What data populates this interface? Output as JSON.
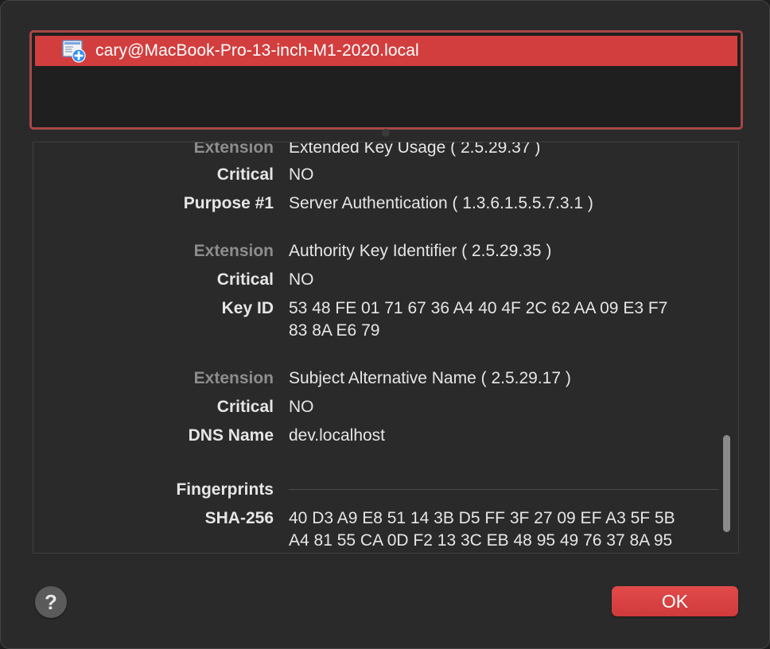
{
  "certificate_list": {
    "selected_item": "cary@MacBook-Pro-13-inch-M1-2020.local",
    "item_icon": "certificate-icon"
  },
  "details": [
    {
      "key": "Extension",
      "value": "Extended Key Usage ( 2.5.29.37 )",
      "dim": true
    },
    {
      "key": "Critical",
      "value": "NO"
    },
    {
      "key": "Purpose #1",
      "value": "Server Authentication ( 1.3.6.1.5.5.7.3.1 )"
    },
    {
      "key": "Extension",
      "value": "Authority Key Identifier ( 2.5.29.35 )",
      "dim": true
    },
    {
      "key": "Critical",
      "value": "NO"
    },
    {
      "key": "Key ID",
      "value": "53 48 FE 01 71 67 36 A4 40 4F 2C 62 AA 09 E3 F7",
      "value2": "83 8A E6 79"
    },
    {
      "key": "Extension",
      "value": "Subject Alternative Name ( 2.5.29.17 )",
      "dim": true
    },
    {
      "key": "Critical",
      "value": "NO"
    },
    {
      "key": "DNS Name",
      "value": "dev.localhost"
    },
    {
      "key": "Fingerprints",
      "value": ""
    },
    {
      "key": "SHA-256",
      "value": "40 D3 A9 E8 51 14 3B D5 FF 3F 27 09 EF A3 5F 5B",
      "value2": "A4 81 55 CA 0D F2 13 3C EB 48 95 49 76 37 8A 95"
    }
  ],
  "buttons": {
    "help": "?",
    "ok": "OK"
  },
  "colors": {
    "selection": "#d23e3e",
    "focus_ring": "#a94747",
    "ok_button": "#d94242"
  }
}
